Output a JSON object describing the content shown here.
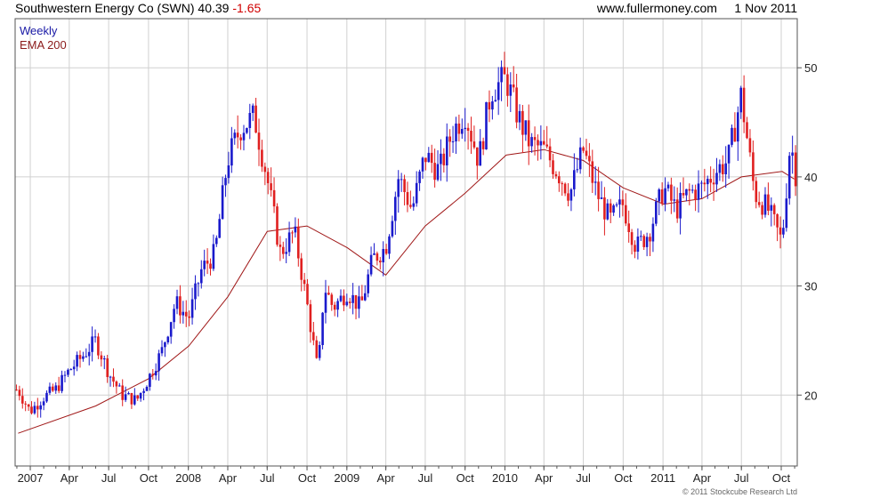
{
  "header": {
    "symbol": "Southwestern Energy Co (SWN)",
    "price": "40.39",
    "change": "-1.65",
    "source": "www.fullermoney.com",
    "date": "1 Nov 2011"
  },
  "footer": {
    "copyright": "© 2011 Stockcube Research Ltd"
  },
  "colors": {
    "up": "#1a1acc",
    "down": "#e02020",
    "ema": "#a01818",
    "grid": "#d0d0d0",
    "frame": "#555555"
  },
  "chart_data": {
    "type": "candlestick",
    "frequency": "weekly",
    "x_tick_labels": [
      "2007",
      "Apr",
      "Jul",
      "Oct",
      "2008",
      "Apr",
      "Jul",
      "Oct",
      "2009",
      "Apr",
      "Jul",
      "Oct",
      "2010",
      "Apr",
      "Jul",
      "Oct",
      "2011",
      "Apr",
      "Jul",
      "Oct"
    ],
    "y_tick_labels": [
      "20",
      "30",
      "40",
      "50"
    ],
    "ylim": [
      13.5,
      54.5
    ],
    "xlim": [
      "2006-11-27",
      "2011-11-07"
    ],
    "grid": true,
    "legend_position": "top-left",
    "series": [
      {
        "name": "Weekly",
        "style": "candlestick-bars",
        "x": [
          "2006-12-04",
          "2007-01-01",
          "2007-02-01",
          "2007-03-01",
          "2007-04-02",
          "2007-05-01",
          "2007-06-01",
          "2007-07-02",
          "2007-08-01",
          "2007-09-04",
          "2007-10-01",
          "2007-11-01",
          "2007-12-03",
          "2008-01-02",
          "2008-02-01",
          "2008-03-03",
          "2008-04-01",
          "2008-05-01",
          "2008-06-02",
          "2008-07-01",
          "2008-08-01",
          "2008-09-02",
          "2008-10-01",
          "2008-10-27",
          "2008-11-10",
          "2008-12-01",
          "2009-01-02",
          "2009-02-02",
          "2009-03-02",
          "2009-04-01",
          "2009-05-01",
          "2009-06-01",
          "2009-07-01",
          "2009-08-03",
          "2009-09-01",
          "2009-10-01",
          "2009-11-02",
          "2009-12-01",
          "2010-01-04",
          "2010-02-01",
          "2010-03-01",
          "2010-04-01",
          "2010-05-03",
          "2010-06-01",
          "2010-07-01",
          "2010-08-02",
          "2010-09-01",
          "2010-10-01",
          "2010-11-01",
          "2010-12-01",
          "2011-01-03",
          "2011-02-01",
          "2011-03-01",
          "2011-04-01",
          "2011-05-02",
          "2011-06-01",
          "2011-07-01",
          "2011-08-01",
          "2011-09-01",
          "2011-10-03",
          "2011-10-24",
          "2011-10-31"
        ],
        "close": [
          20.5,
          18.5,
          19.8,
          20.5,
          22.3,
          23.5,
          25.0,
          22.0,
          20.0,
          19.5,
          21.5,
          24.0,
          28.5,
          27.0,
          31.5,
          33.0,
          41.5,
          44.5,
          45.5,
          40.0,
          33.0,
          35.0,
          28.5,
          22.0,
          30.0,
          28.0,
          29.5,
          28.0,
          32.5,
          33.5,
          40.0,
          37.0,
          42.0,
          40.5,
          44.0,
          46.0,
          41.5,
          48.0,
          49.0,
          45.5,
          43.0,
          42.5,
          40.5,
          38.5,
          42.5,
          38.5,
          36.0,
          37.5,
          33.5,
          35.0,
          39.0,
          37.0,
          38.5,
          39.0,
          40.5,
          41.5,
          47.5,
          38.5,
          37.0,
          34.0,
          44.0,
          40.39
        ]
      },
      {
        "name": "EMA 200",
        "style": "line",
        "x": [
          "2006-12-04",
          "2007-06-01",
          "2007-10-01",
          "2008-01-02",
          "2008-04-01",
          "2008-07-01",
          "2008-10-01",
          "2009-01-02",
          "2009-04-01",
          "2009-07-01",
          "2009-10-01",
          "2010-01-04",
          "2010-04-01",
          "2010-07-01",
          "2010-10-01",
          "2011-01-03",
          "2011-04-01",
          "2011-07-01",
          "2011-10-03",
          "2011-10-31"
        ],
        "values": [
          16.5,
          19.0,
          21.5,
          24.5,
          29.0,
          35.0,
          35.5,
          33.5,
          31.0,
          35.5,
          38.5,
          42.0,
          42.5,
          41.5,
          39.0,
          37.5,
          38.0,
          40.0,
          40.5,
          39.8
        ]
      }
    ]
  }
}
